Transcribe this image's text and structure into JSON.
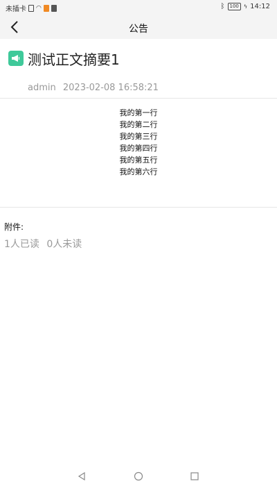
{
  "status_bar": {
    "carrier": "未插卡",
    "battery": "100",
    "time": "14:12"
  },
  "header": {
    "title": "公告"
  },
  "notice": {
    "title": "测试正文摘要1",
    "author": "admin",
    "datetime": "2023-02-08 16:58:21",
    "lines": [
      "我的第一行",
      "我的第二行",
      "我的第三行",
      "我的第四行",
      "我的第五行",
      "我的第六行"
    ],
    "attachment_label": "附件:",
    "read_count": "1人已读",
    "unread_count": "0人未读"
  },
  "colors": {
    "accent": "#3fc99a",
    "meta_text": "#999999"
  }
}
